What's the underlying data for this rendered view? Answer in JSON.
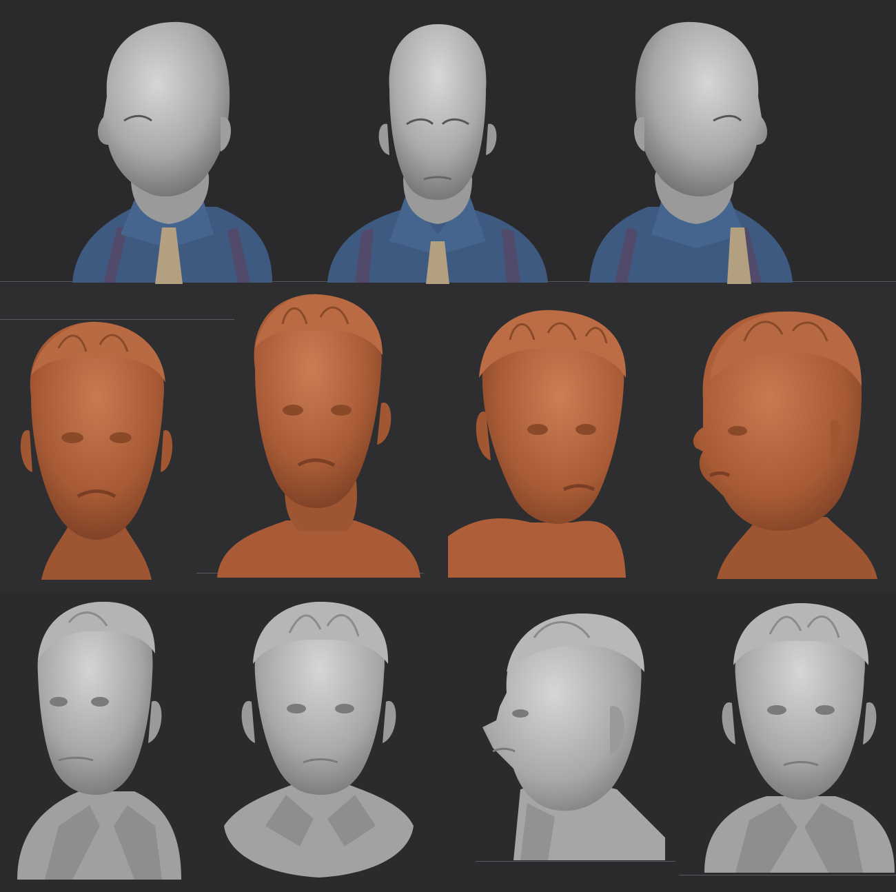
{
  "sheet": {
    "rows": [
      {
        "name": "bald-blue-shirt-row",
        "count": 3
      },
      {
        "name": "clay-head-row",
        "count": 4
      },
      {
        "name": "grey-shirt-bust-row",
        "count": 4
      }
    ]
  },
  "colors": {
    "background": "#2b2b2d",
    "grey_skin": "#b4b4b4",
    "grey_skin_dark": "#6e6e6e",
    "shirt_blue": "#3e5a80",
    "suspender": "#524a6a",
    "tie": "#b3a080",
    "clay": "#b5663f",
    "clay_dark": "#7a3f25"
  }
}
